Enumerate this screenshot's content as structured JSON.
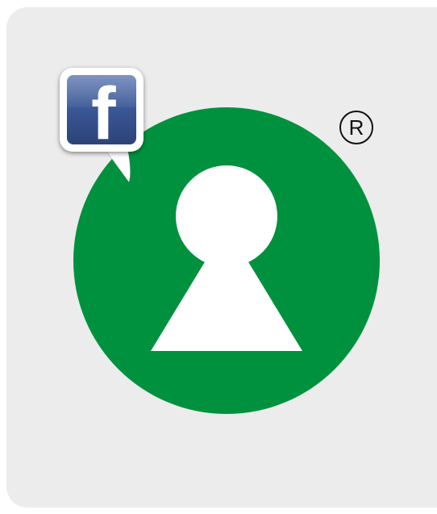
{
  "logo": {
    "circle_color": "#00913f",
    "keyhole_color": "#ffffff",
    "background_color": "#ececec",
    "registered_mark": "R",
    "icon": "keyhole-person-icon"
  },
  "facebook_badge": {
    "letter": "f",
    "brand_color": "#3b5998",
    "icon": "facebook-speech-bubble-icon"
  }
}
